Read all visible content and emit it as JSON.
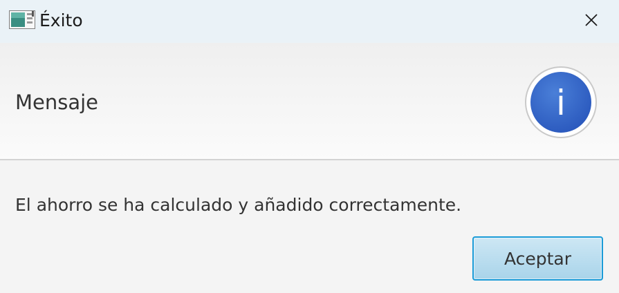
{
  "window": {
    "title": "Éxito",
    "app_icon": "app-window-icon",
    "close_icon": "close-icon"
  },
  "header": {
    "text": "Mensaje",
    "icon": "information-icon",
    "icon_glyph": "i",
    "icon_color": "#2f62c4"
  },
  "content": {
    "message": "El ahorro se ha calculado y añadido correctamente."
  },
  "buttons": {
    "accept_label": "Aceptar"
  },
  "colors": {
    "accent": "#1a9bd7",
    "button_fill": "#b7dcef",
    "titlebar": "#eaf2f7"
  }
}
